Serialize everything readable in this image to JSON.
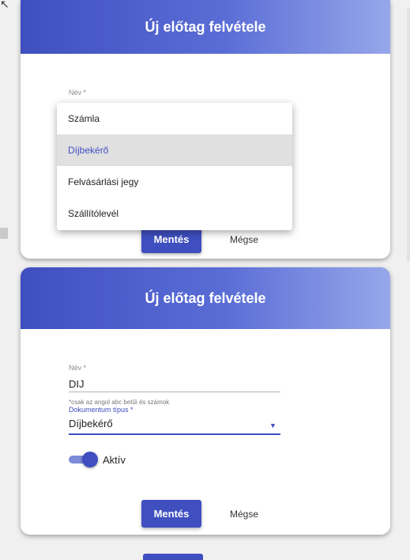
{
  "top_dialog": {
    "title": "Új előtag felvétele",
    "name_label": "Név *",
    "save_label": "Mentés",
    "cancel_label": "Mégse"
  },
  "dropdown": {
    "options": [
      {
        "label": "Számla",
        "selected": false
      },
      {
        "label": "Díjbekérő",
        "selected": true
      },
      {
        "label": "Felvásárlási jegy",
        "selected": false
      },
      {
        "label": "Szállítólevél",
        "selected": false
      }
    ]
  },
  "bottom_dialog": {
    "title": "Új előtag felvétele",
    "name_label": "Név *",
    "name_value": "DIJ",
    "name_hint": "*csak az angol abc betűi és számok",
    "doc_type_label": "Dokumentum típus *",
    "doc_type_value": "Díjbekérő",
    "active_label": "Aktív",
    "active": true,
    "save_label": "Mentés",
    "cancel_label": "Mégse"
  },
  "colors": {
    "accent": "#3f4fc0",
    "header_gradient_end": "#97a7ea"
  }
}
